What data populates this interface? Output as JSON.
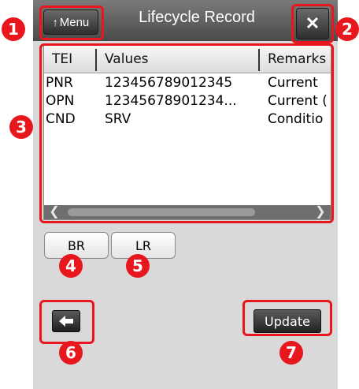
{
  "window": {
    "title": "Lifecycle Record",
    "menu_label": "Menu",
    "close_label": "✕"
  },
  "table": {
    "headers": [
      "TEI",
      "Values",
      "Remarks"
    ],
    "rows": [
      [
        "PNR",
        "123456789012345",
        "Current"
      ],
      [
        "OPN",
        "12345678901234...",
        "Current ("
      ],
      [
        "CND",
        "SRV",
        "Conditio"
      ]
    ]
  },
  "buttons": {
    "br_label": "BR",
    "lr_label": "LR",
    "update_label": "Update"
  },
  "callouts": [
    "1",
    "2",
    "3",
    "4",
    "5",
    "6",
    "7"
  ],
  "colors": {
    "highlight": "#e8161d",
    "titlebar": "#5a5a5a",
    "background": "#d9d9d9"
  }
}
